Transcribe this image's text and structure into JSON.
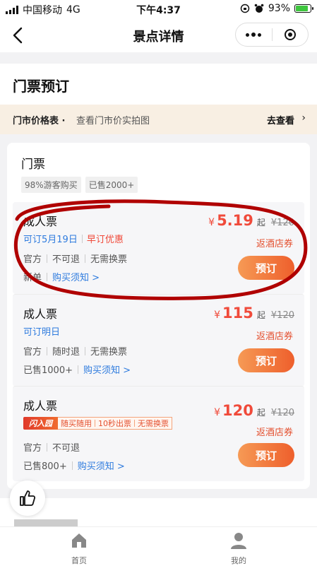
{
  "status_bar": {
    "carrier": "中国移动",
    "network": "4G",
    "time": "下午4:37",
    "battery": "93%",
    "battery_level": 0.93
  },
  "nav": {
    "title": "景点详情"
  },
  "section": {
    "title": "门票预订"
  },
  "price_banner": {
    "title": "门市价格表",
    "dot": "·",
    "subtitle": "查看门市价实拍图",
    "link": "去查看",
    "arrow": "›"
  },
  "ticket_card": {
    "title": "门票",
    "chips": [
      "98%游客购买",
      "已售2000+"
    ],
    "tickets": [
      {
        "name": "成人票",
        "availability": "可订5月19日",
        "promo": "早订优惠",
        "rules": [
          "官方",
          "不可退",
          "无需换票"
        ],
        "sold": "新单",
        "notice": "购买须知 >",
        "currency": "¥",
        "price": "5.19",
        "qi": "起",
        "original": "¥120",
        "coupon": "返酒店券",
        "book": "预订"
      },
      {
        "name": "成人票",
        "availability": "可订明日",
        "rules": [
          "官方",
          "随时退",
          "无需换票"
        ],
        "sold": "已售1000+",
        "notice": "购买须知 >",
        "currency": "¥",
        "price": "115",
        "qi": "起",
        "original": "¥120",
        "coupon": "返酒店券",
        "book": "预订"
      },
      {
        "name": "成人票",
        "tag_logo": "闪入园",
        "tag_features": [
          "随买随用",
          "10秒出票",
          "无需换票"
        ],
        "rules": [
          "官方",
          "不可退"
        ],
        "sold": "已售800+",
        "notice": "购买须知 >",
        "currency": "¥",
        "price": "120",
        "qi": "起",
        "original": "¥120",
        "coupon": "返酒店券",
        "book": "预订"
      }
    ]
  },
  "tab_bar": {
    "home": "首页",
    "mine": "我的"
  },
  "colors": {
    "accent": "#ee5f2c",
    "price": "#f04a3a",
    "link": "#2e7bde",
    "annotation": "#b00000"
  },
  "icons": [
    "back-icon",
    "more-dots-icon",
    "close-target-icon",
    "chevron-right-icon",
    "thumbs-up-icon",
    "home-icon",
    "user-icon"
  ]
}
